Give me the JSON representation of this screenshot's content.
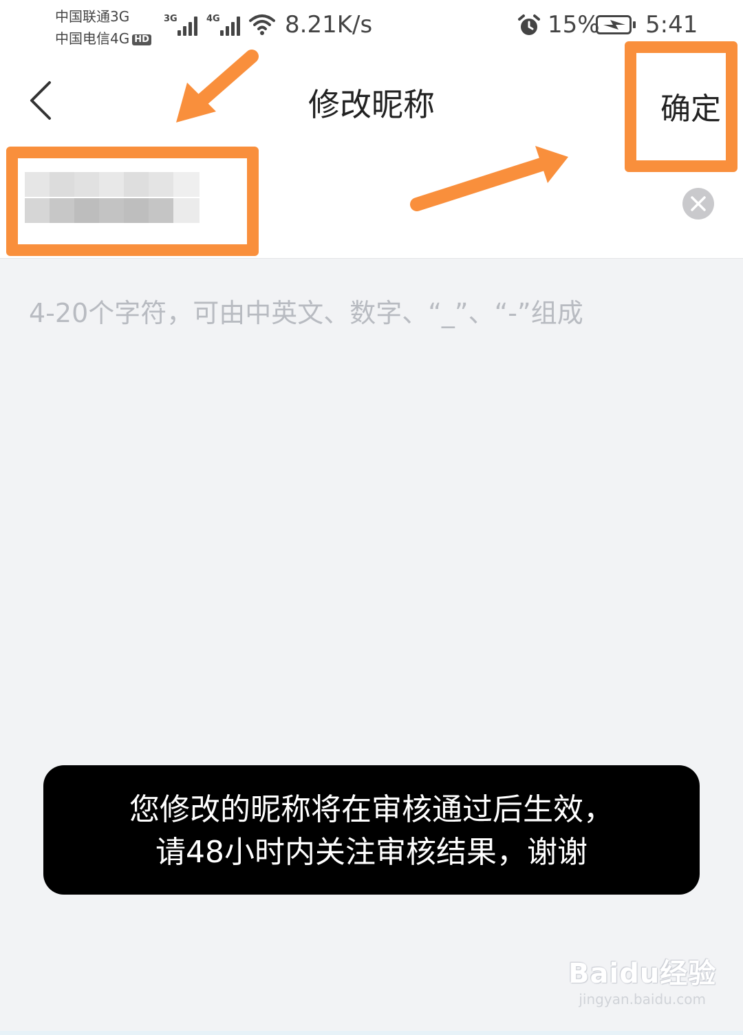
{
  "status_bar": {
    "carrier1": "中国联通3G",
    "carrier2": "中国电信4G",
    "hd_badge": "HD",
    "sim1_network": "3G",
    "sim2_network": "4G",
    "net_speed": "8.21K/s",
    "battery_percent": "15%",
    "time": "5:41",
    "icons": [
      "signal-icon",
      "wifi-icon",
      "alarm-icon",
      "battery-charging-icon"
    ]
  },
  "nav": {
    "back_icon": "chevron-left-icon",
    "title": "修改昵称",
    "confirm_label": "确定"
  },
  "nickname_input": {
    "value": "",
    "state": "pixelated / blurred",
    "clear_icon": "close-circle-icon"
  },
  "hint": "4-20个字符，可由中英文、数字、“_”、“-”组成",
  "toast": {
    "line1": "您修改的昵称将在审核通过后生效，",
    "line2": "请48小时内关注审核结果，谢谢"
  },
  "annotations": {
    "color": "#f98f3c",
    "items": [
      "highlight-box-input",
      "highlight-box-confirm",
      "arrow-to-input",
      "arrow-to-confirm"
    ]
  },
  "watermark": {
    "main": "Baidu经验",
    "sub": "jingyan.baidu.com"
  }
}
